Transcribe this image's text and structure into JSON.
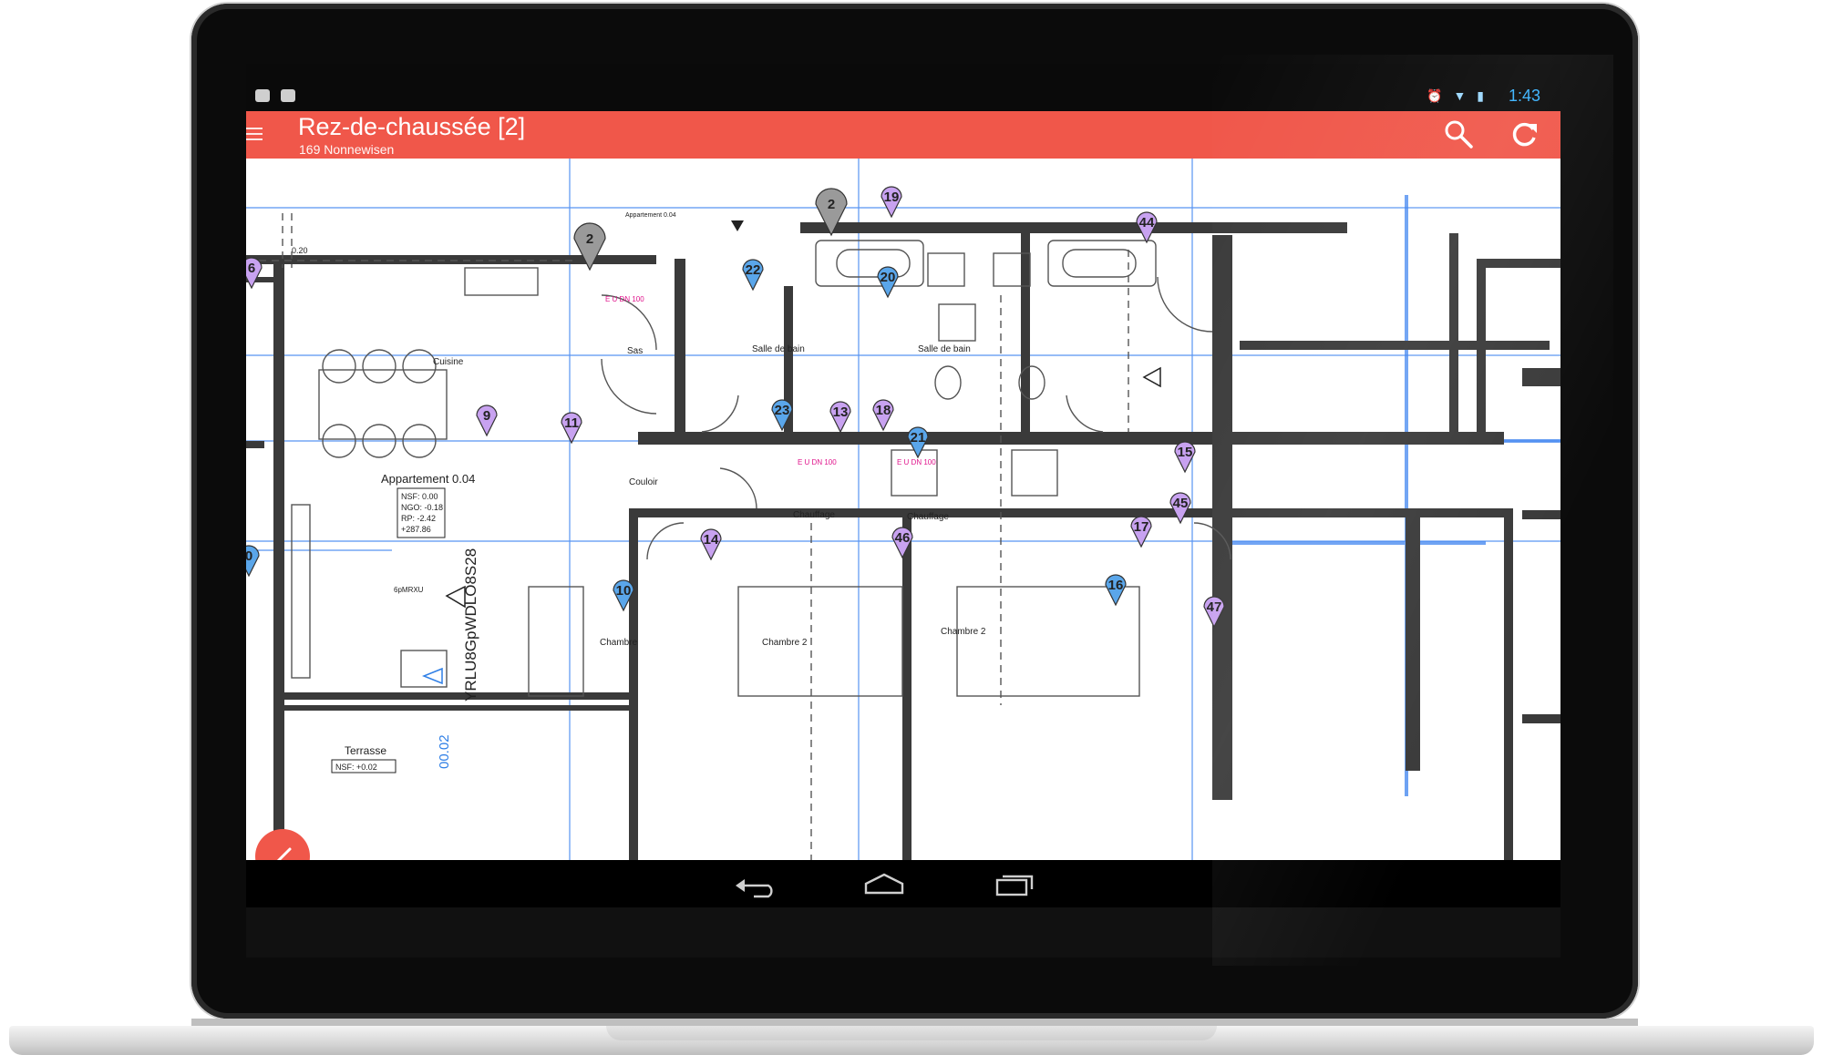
{
  "status_bar": {
    "time": "1:43"
  },
  "action_bar": {
    "title": "Rez-de-chaussée [2]",
    "subtitle": "169 Nonnewisen"
  },
  "plan": {
    "rooms": {
      "cuisine": "Cuisine",
      "sas": "Sas",
      "salle_bain_left": "Salle de bain",
      "salle_bain_right": "Salle de bain",
      "couloir": "Couloir",
      "chauffage_left": "Chauffage",
      "chauffage_right": "Chauffage",
      "chambre_left": "Chambre",
      "chambre_2_mid": "Chambre 2",
      "chambre_2_right": "Chambre 2",
      "terrasse": "Terrasse",
      "appartement": "Appartement 0.04"
    },
    "labels": {
      "top_note": "Appartement 0.04",
      "eu_dn_1": "E U DN 100",
      "eu_dn_2": "E U DN 100",
      "eu_dn_3": "E U DN 100",
      "dim_020": "0.20",
      "dim_002": "00.02",
      "vertical_code": "YRLU8GpWDLO8S28",
      "code_6p": "6pMRXU"
    },
    "info_box": [
      "NSF: 0.00",
      "NGO: -0.18",
      "RP: -2.42",
      "+287.86"
    ],
    "terrasse_box": "NSF: +0.02",
    "pins": [
      {
        "n": "6"
      },
      {
        "n": "2"
      },
      {
        "n": "2"
      },
      {
        "n": "19"
      },
      {
        "n": "44"
      },
      {
        "n": "22"
      },
      {
        "n": "20"
      },
      {
        "n": "9"
      },
      {
        "n": "11"
      },
      {
        "n": "23"
      },
      {
        "n": "13"
      },
      {
        "n": "18"
      },
      {
        "n": "21"
      },
      {
        "n": "15"
      },
      {
        "n": "45"
      },
      {
        "n": "17"
      },
      {
        "n": "14"
      },
      {
        "n": "46"
      },
      {
        "n": "10"
      },
      {
        "n": "16"
      },
      {
        "n": "47"
      },
      {
        "n": "0"
      }
    ]
  },
  "icons": {
    "menu": "menu-icon",
    "search": "search-icon",
    "refresh": "refresh-icon",
    "back": "back-icon",
    "home": "home-icon",
    "recents": "recents-icon",
    "edit": "edit-icon"
  },
  "colors": {
    "action_bar": "#f0574a",
    "status_time": "#39b3ff",
    "pin_purple": "#c8a2f0",
    "pin_blue": "#5aa6ea",
    "pin_gray": "#9a9a9a",
    "gridline": "#3b82f0",
    "wall": "#3a3a3a"
  }
}
